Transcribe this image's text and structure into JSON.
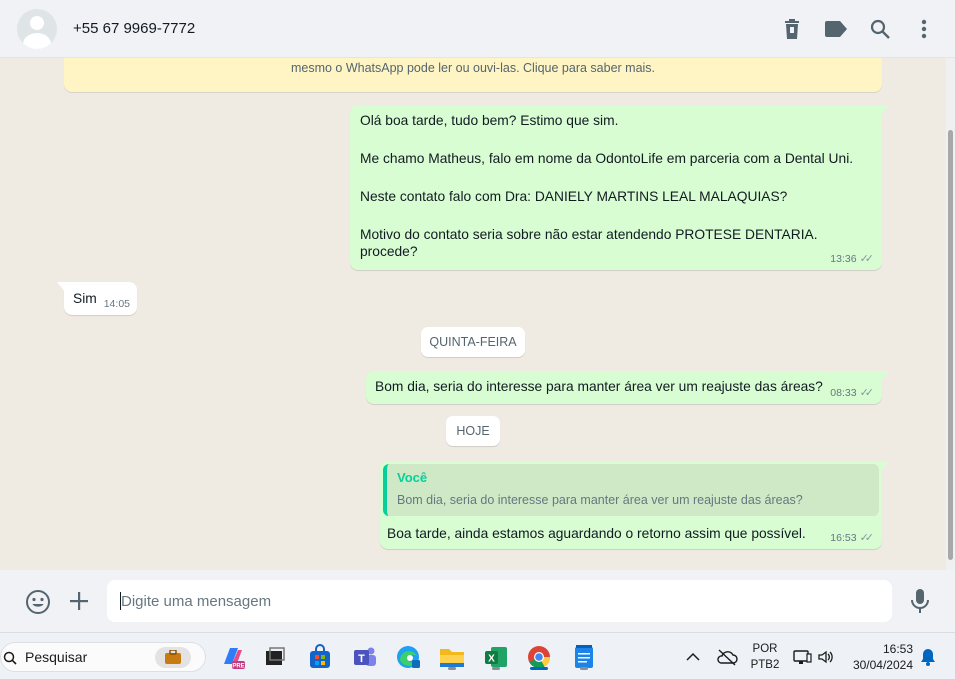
{
  "header": {
    "contact_name": "+55 67 9969-7772",
    "icons": [
      "delete-icon",
      "label-icon",
      "search-icon",
      "more-vertical-icon"
    ]
  },
  "notice": {
    "text": "mesmo o WhatsApp pode ler ou ouvi-las. Clique para saber mais."
  },
  "messages": [
    {
      "direction": "out",
      "lines": [
        "Olá boa tarde, tudo bem? Estimo que sim.",
        "Me chamo Matheus, falo em nome da OdontoLife em parceria com a Dental Uni.",
        "Neste contato falo com Dra: DANIELY MARTINS LEAL MALAQUIAS?",
        "Motivo do contato seria sobre não estar atendendo PROTESE DENTARIA. procede?"
      ],
      "time": "13:36"
    },
    {
      "direction": "in",
      "text": "Sim",
      "time": "14:05"
    },
    {
      "direction": "out",
      "text": "Bom dia, seria do interesse para manter área ver um reajuste das áreas?",
      "time": "08:33"
    },
    {
      "direction": "out",
      "quote_author": "Você",
      "quote_text": "Bom dia, seria do interesse para manter área ver um reajuste das áreas?",
      "text": "Boa tarde, ainda estamos aguardando o retorno assim que possível.",
      "time": "16:53"
    }
  ],
  "date_dividers": [
    "QUINTA-FEIRA",
    "HOJE"
  ],
  "composer": {
    "placeholder": "Digite uma mensagem"
  },
  "taskbar": {
    "search_placeholder": "Pesquisar",
    "language": [
      "POR",
      "PTB2"
    ],
    "time": "16:53",
    "date": "30/04/2024"
  },
  "colors": {
    "outgoing_bubble": "#d9fdd3",
    "incoming_bubble": "#ffffff",
    "chat_background": "#efeae2",
    "notice_background": "#fff5c4",
    "quote_accent": "#06cf9c"
  }
}
